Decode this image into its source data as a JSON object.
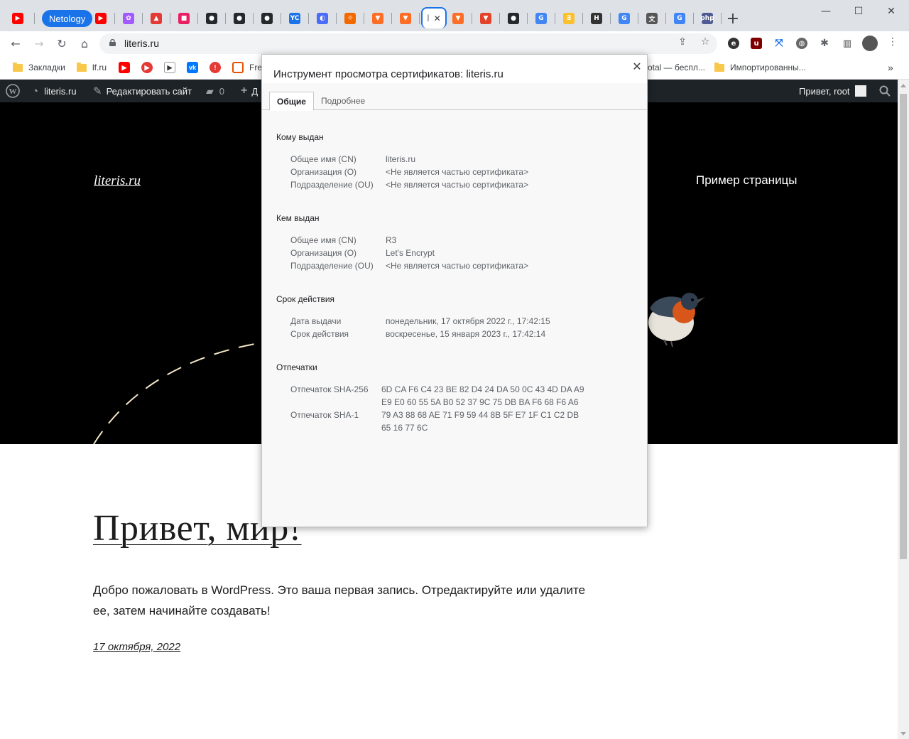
{
  "tabs": {
    "netology_label": "Netology",
    "active_tab_label": "l",
    "favicons": [
      {
        "name": "youtube-favicon-icon",
        "color": "#ff0000",
        "glyph": "▶"
      },
      {
        "name": "figma-favicon-icon",
        "color": "#a259ff",
        "glyph": "✿"
      },
      {
        "name": "red-app-favicon-icon",
        "color": "#e53935",
        "glyph": "▲"
      },
      {
        "name": "pink-app-favicon-icon",
        "color": "#e91e63",
        "glyph": "■"
      },
      {
        "name": "github-favicon-icon",
        "color": "#24292e",
        "glyph": "●"
      },
      {
        "name": "github-favicon-icon",
        "color": "#24292e",
        "glyph": "●"
      },
      {
        "name": "github-favicon-icon",
        "color": "#24292e",
        "glyph": "●"
      },
      {
        "name": "yc-favicon-icon",
        "color": "#1a73e8",
        "glyph": "YC"
      },
      {
        "name": "blue-app-favicon-icon",
        "color": "#4a6cf7",
        "glyph": "◐"
      },
      {
        "name": "grafana-favicon-icon",
        "color": "#f46800",
        "glyph": "☼"
      },
      {
        "name": "gitlab-fox-favicon-icon",
        "color": "#fc6d26",
        "glyph": "▼"
      },
      {
        "name": "gitlab-fox-favicon-icon",
        "color": "#fc6d26",
        "glyph": "▼"
      }
    ],
    "favicons_right": [
      {
        "name": "gitlab-favicon-icon",
        "color": "#fc6d26",
        "glyph": "▼"
      },
      {
        "name": "gitlab-check-favicon-icon",
        "color": "#e24329",
        "glyph": "▼"
      },
      {
        "name": "github-favicon-icon",
        "color": "#24292e",
        "glyph": "●"
      },
      {
        "name": "google-favicon-icon",
        "color": "#4285f4",
        "glyph": "G"
      },
      {
        "name": "yellow-app-favicon-icon",
        "color": "#fbc02d",
        "glyph": "∃"
      },
      {
        "name": "habr-favicon-icon",
        "color": "#333333",
        "glyph": "Н"
      },
      {
        "name": "google-favicon-icon",
        "color": "#4285f4",
        "glyph": "G"
      },
      {
        "name": "translate-favicon-icon",
        "color": "#555555",
        "glyph": "文"
      },
      {
        "name": "google-favicon-icon",
        "color": "#4285f4",
        "glyph": "G"
      },
      {
        "name": "php-favicon-icon",
        "color": "#4f5b93",
        "glyph": "php"
      }
    ]
  },
  "toolbar": {
    "url": "literis.ru"
  },
  "bookmarks": {
    "items": [
      {
        "label": "Закладки",
        "type": "folder"
      },
      {
        "label": "lf.ru",
        "type": "folder"
      },
      {
        "label": "Fre",
        "type": "icon"
      },
      {
        "label": "otal — беспл...",
        "type": "text"
      },
      {
        "label": "Импортированны...",
        "type": "folder"
      }
    ],
    "more": "»"
  },
  "wpbar": {
    "site": "literis.ru",
    "edit": "Редактировать сайт",
    "comments": "0",
    "new_partial": "Д",
    "greeting": "Привет, root"
  },
  "site": {
    "title": "literis.ru",
    "menu_link": "Пример страницы",
    "post_title": "Привет, мир!",
    "post_body": "Добро пожаловать в WordPress. Это ваша первая запись. Отредактируйте или удалите ее, затем начинайте создавать!",
    "post_date": "17 октября, 2022"
  },
  "dialog": {
    "title": "Инструмент просмотра сертификатов: literis.ru",
    "close": "✕",
    "tab_general": "Общие",
    "tab_details": "Подробнее",
    "issued_to": {
      "title": "Кому выдан",
      "cn_label": "Общее имя (CN)",
      "cn_value": "literis.ru",
      "o_label": "Организация (O)",
      "o_value": "<Не является частью сертификата>",
      "ou_label": "Подразделение (OU)",
      "ou_value": "<Не является частью сертификата>"
    },
    "issued_by": {
      "title": "Кем выдан",
      "cn_label": "Общее имя (CN)",
      "cn_value": "R3",
      "o_label": "Организация (O)",
      "o_value": "Let's Encrypt",
      "ou_label": "Подразделение (OU)",
      "ou_value": "<Не является частью сертификата>"
    },
    "validity": {
      "title": "Срок действия",
      "issued_label": "Дата выдачи",
      "issued_value": "понедельник, 17 октября 2022 г., 17:42:15",
      "expires_label": "Срок действия",
      "expires_value": "воскресенье, 15 января 2023 г., 17:42:14"
    },
    "fingerprints": {
      "title": "Отпечатки",
      "sha256_label": "Отпечаток SHA-256",
      "sha256_value": "6D CA F6 C4 23 BE 82 D4 24 DA 50 0C 43 4D DA A9 E9 E0 60 55 5A B0 52 37 9C 75 DB BA F6 68 F6 A6",
      "sha1_label": "Отпечаток SHA-1",
      "sha1_value": "79 A3 88 68 AE 71 F9 59 44 8B 5F E7 1F C1 C2 DB 65 16 77 6C"
    }
  }
}
